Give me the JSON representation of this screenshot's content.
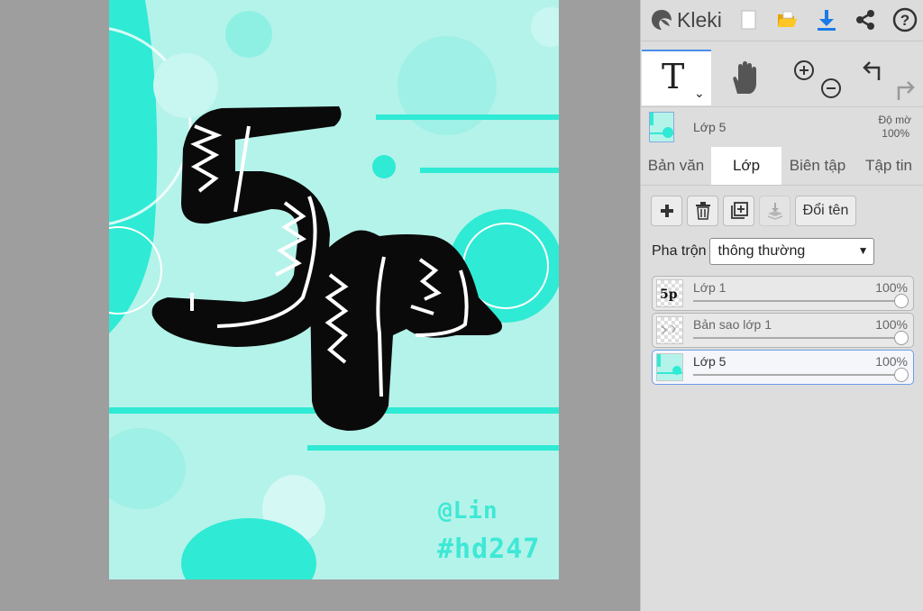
{
  "app": {
    "name": "Kleki"
  },
  "canvas": {
    "signature_name": "@Lin",
    "signature_tag": "#hd247"
  },
  "header": {
    "icons": [
      "new-file-icon",
      "open-folder-icon",
      "download-icon",
      "share-icon",
      "help-icon"
    ],
    "accent_color": "#1a7be6"
  },
  "current_layer": {
    "name": "Lớp 5",
    "opacity_label": "Độ mờ",
    "opacity_value": "100%"
  },
  "tabs": [
    {
      "label": "Bản văn",
      "active": false
    },
    {
      "label": "Lớp",
      "active": true
    },
    {
      "label": "Biên tập",
      "active": false
    },
    {
      "label": "Tập tin",
      "active": false
    }
  ],
  "layer_actions": {
    "rename_label": "Đổi tên"
  },
  "blend": {
    "label": "Pha trộn",
    "value": "thông thường"
  },
  "layers": [
    {
      "name": "Lớp 1",
      "opacity": "100%",
      "opacity_value": 1.0,
      "selected": false
    },
    {
      "name": "Bản sao lớp 1",
      "opacity": "100%",
      "opacity_value": 1.0,
      "selected": false
    },
    {
      "name": "Lớp 5",
      "opacity": "100%",
      "opacity_value": 1.0,
      "selected": true
    }
  ],
  "colors": {
    "canvas_background": "#b4f3ea",
    "shape_color": "#22e8d2",
    "selection_border": "#6d9ee8"
  }
}
